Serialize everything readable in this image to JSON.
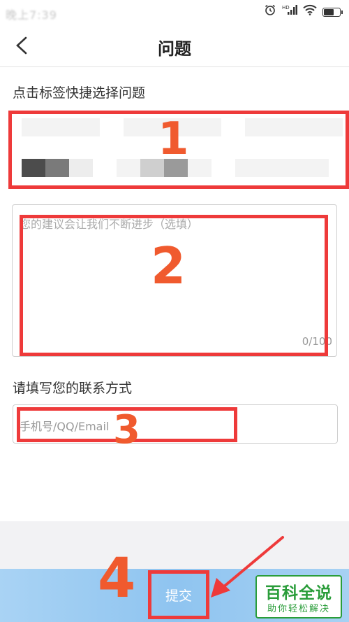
{
  "status_bar": {
    "time": "晚上7:39",
    "icons": [
      "alarm-icon",
      "hd-signal-icon",
      "wifi-icon",
      "battery-icon"
    ]
  },
  "header": {
    "title": "问题",
    "back_icon": "chevron-left-icon"
  },
  "tags_section": {
    "label": "点击标签快捷选择问题"
  },
  "feedback": {
    "placeholder": "您的建议会让我们不断进步（选填）",
    "count": "0/100"
  },
  "contact_section": {
    "label": "请填写您的联系方式",
    "placeholder": "手机号/QQ/Email"
  },
  "submit": {
    "label": "提交"
  },
  "annotations": {
    "n1": "1",
    "n2": "2",
    "n3": "3",
    "n4": "4"
  },
  "logo": {
    "main": "百科全说",
    "sub": "助你轻松解决"
  },
  "colors": {
    "annotation_red": "#ee3a3a",
    "number_orange": "#f05a2e",
    "submit_blue": "#8fc4f0",
    "logo_green": "#2a9d3a"
  }
}
